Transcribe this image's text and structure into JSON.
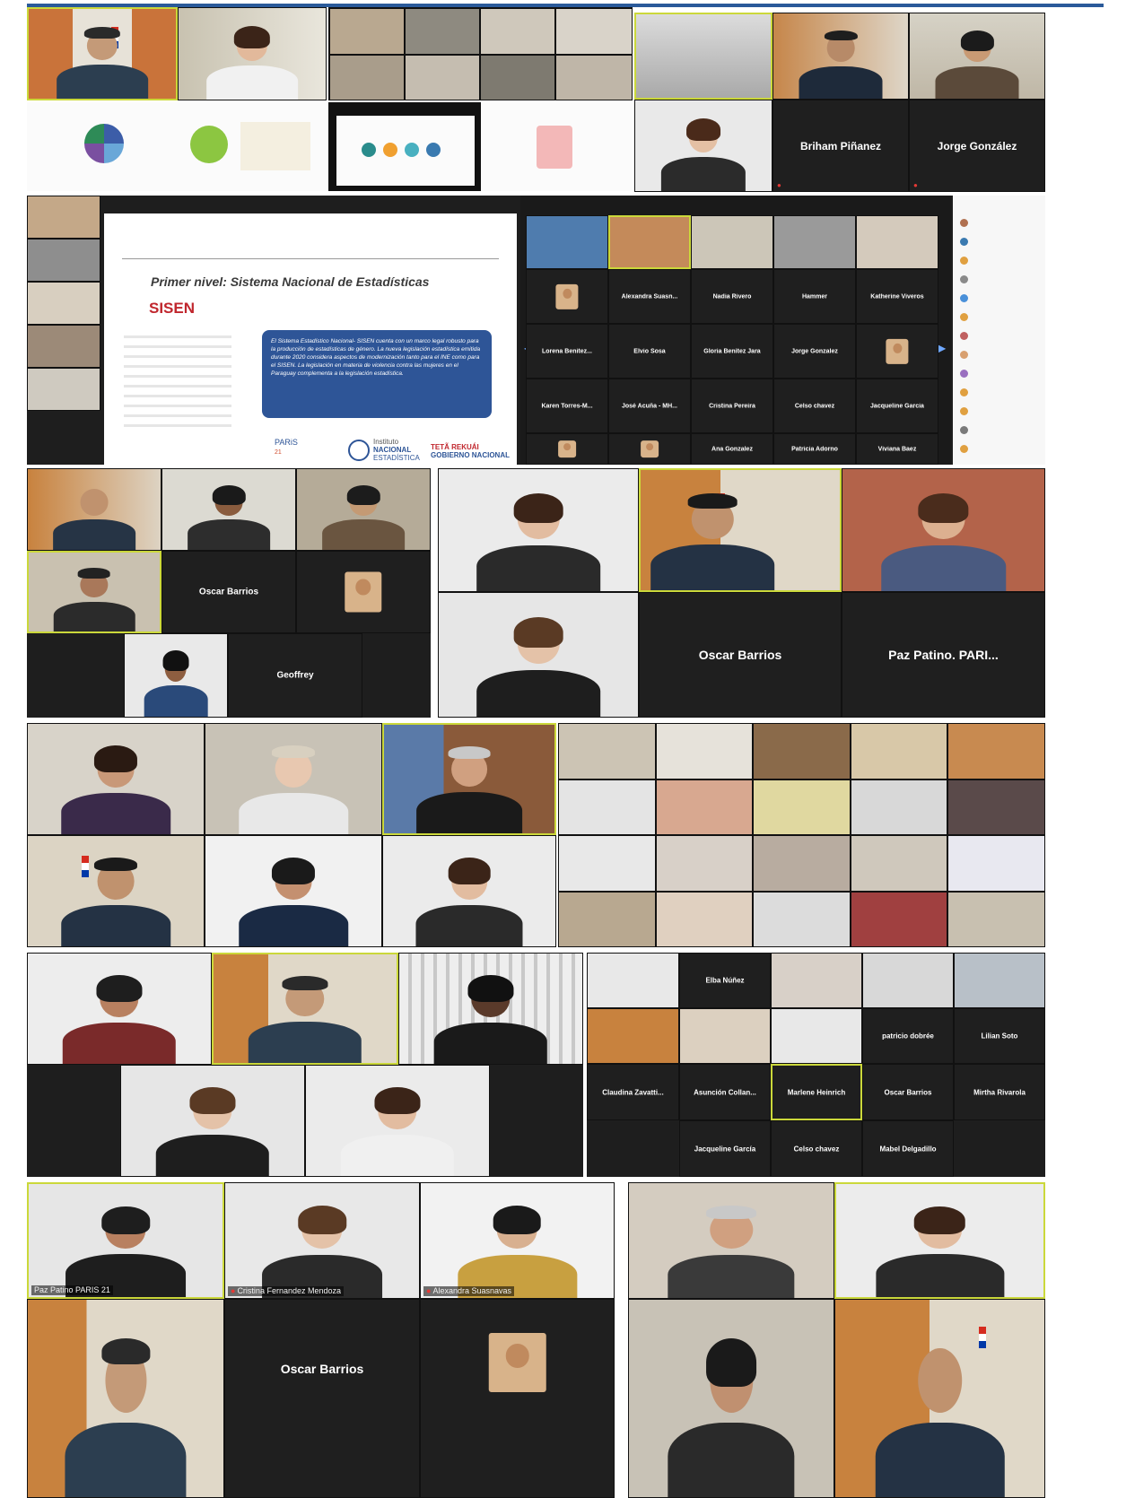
{
  "colors": {
    "frame_border": "#2a5a9a",
    "zoom_dark": "#1f1f1f",
    "active_speaker": "#cbd83a",
    "slide_box": "#2e5597",
    "sisen_red": "#c0262d",
    "mic_muted": "#e53935"
  },
  "icons": {
    "muted_mic": "muted-mic-icon",
    "arrow_left": "arrow-left-icon",
    "arrow_right": "arrow-right-icon",
    "ine_seal": "seal-icon"
  },
  "panel1": {
    "tiles": [
      {
        "name": "Briham Piñanez"
      },
      {
        "name": "Jorge González"
      }
    ]
  },
  "panel2": {
    "slide": {
      "title": "Primer nivel: Sistema Nacional de Estadísticas",
      "logo": "SISEN",
      "box_text": "El Sistema Estadístico Nacional- SISEN cuenta con un marco legal robusto para la producción de estadísticas de género. La nueva legislación estadística emitida durante 2020 considera aspectos de modernización tanto para el INE como para el SISEN. La legislación en materia de violencia contra las mujeres en el Paraguay complementa a la legislación estadística.",
      "paris": "PARiS",
      "paris_sub": "21",
      "ine_line1": "Instituto",
      "ine_line2": "NACIONAL",
      "ine_line3": "ESTADÍSTICA",
      "gov_line1": "TETÃ REKUÁI",
      "gov_line2": "GOBIERNO NACIONAL"
    },
    "grid_names": [
      "Alexandra Suasn...",
      "Nadia Rivero",
      "Hammer",
      "Katherine Viveros",
      "Lorena Benitez...",
      "Elvio Sosa",
      "Gloria Benítez Jara",
      "Jorge Gonzalez",
      "Karen Torres-M...",
      "José Acuña - MH...",
      "Cristina Pereira",
      "Celso chavez",
      "Jacqueline Garcia",
      "Ana Gonzalez",
      "Patricia Adorno",
      "Viviana Baez"
    ]
  },
  "panel3": {
    "left_names": [
      "Oscar Barrios",
      "Geoffrey"
    ],
    "right_names": [
      "Oscar Barrios",
      "Paz Patino. PARI..."
    ]
  },
  "panel5": {
    "names": [
      "Elba Núñez",
      "patricio dobrée",
      "Lilian Soto",
      "Claudina Zavatti...",
      "Asunción Collan...",
      "Marlene Heinrich",
      "Oscar Barrios",
      "Mirtha Rivarola",
      "Jacqueline García",
      "Celso chavez",
      "Mabel Delgadillo"
    ]
  },
  "panel6": {
    "labels": [
      "Paz Patino PARIS 21",
      "Cristina Fernandez Mendoza",
      "Alexandra Suasnavas"
    ],
    "big_name": "Oscar Barrios"
  }
}
